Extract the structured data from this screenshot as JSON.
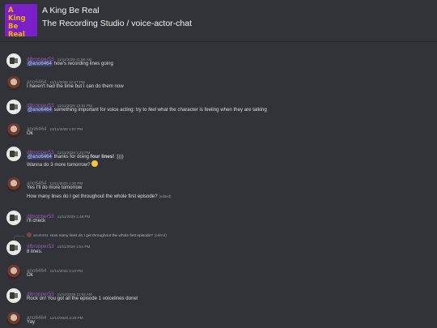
{
  "server": {
    "icon_text": [
      "A",
      "King",
      "Be",
      "Real"
    ],
    "name": "A King Be Real",
    "channel_path": "The Recording Studio / voice-actor-chat"
  },
  "colors": {
    "purple_author": "#9b59b6",
    "gray_author": "#80848e",
    "mention_bg": "#3c4270"
  },
  "messages": [
    {
      "author": "dlbropper53",
      "timestamp": "11/11/2025 11:56 AM",
      "mention": "@ano6464",
      "text": " how's recording lines going"
    },
    {
      "author": "ano6464",
      "timestamp": "11/11/2025 12:27 PM",
      "text": "I haven't had the time but I can do them now"
    },
    {
      "author": "dlbropper53",
      "timestamp": "11/11/2025 12:51 PM",
      "mention": "@ano6464",
      "text_before_em": " something important for voice acting: try to ",
      "em": "feel",
      "text_after_em": " what the character is feeling when they are talking"
    },
    {
      "author": "ano6464",
      "timestamp": "11/11/2025 1:07 PM",
      "text": "Ok"
    },
    {
      "author": "dlbropper53",
      "timestamp": "11/11/2025 1:22 PM",
      "mention": "@ano6464",
      "text_before_bold": " thanks for doing ",
      "bold": "four lines!",
      "text_after_bold": " :))))",
      "line2": "Wanna do 3 more tomorrow?",
      "emoji": "smiling-face-emoji"
    },
    {
      "author": "ano6464",
      "timestamp": "11/11/2025 1:30 PM",
      "text": "Yes I'll do more tomorrow",
      "line2": "How many lines do I get throughout the whole first episode?",
      "edited": "(edited)"
    },
    {
      "author": "dlbropper53",
      "timestamp": "11/11/2025 1:48 PM",
      "text": "I'll check"
    },
    {
      "reply_author": "ano6464",
      "reply_text": "How many lines do I get throughout the whole first episode?",
      "reply_edited": "(edited)",
      "author": "dlbropper53",
      "timestamp": "11/11/2025 1:51 PM",
      "text": "8 lines."
    },
    {
      "author": "ano6464",
      "timestamp": "11/11/2025 3:13 PM",
      "text": "Ok"
    },
    {
      "author": "dlbropper53",
      "timestamp": "11/12/2025 11:52 AM",
      "text": "Rock on! You got all the episode 1 voicelines done!"
    },
    {
      "author": "ano6464",
      "timestamp": "11/12/2025 2:25 PM",
      "text": "Yay"
    }
  ]
}
